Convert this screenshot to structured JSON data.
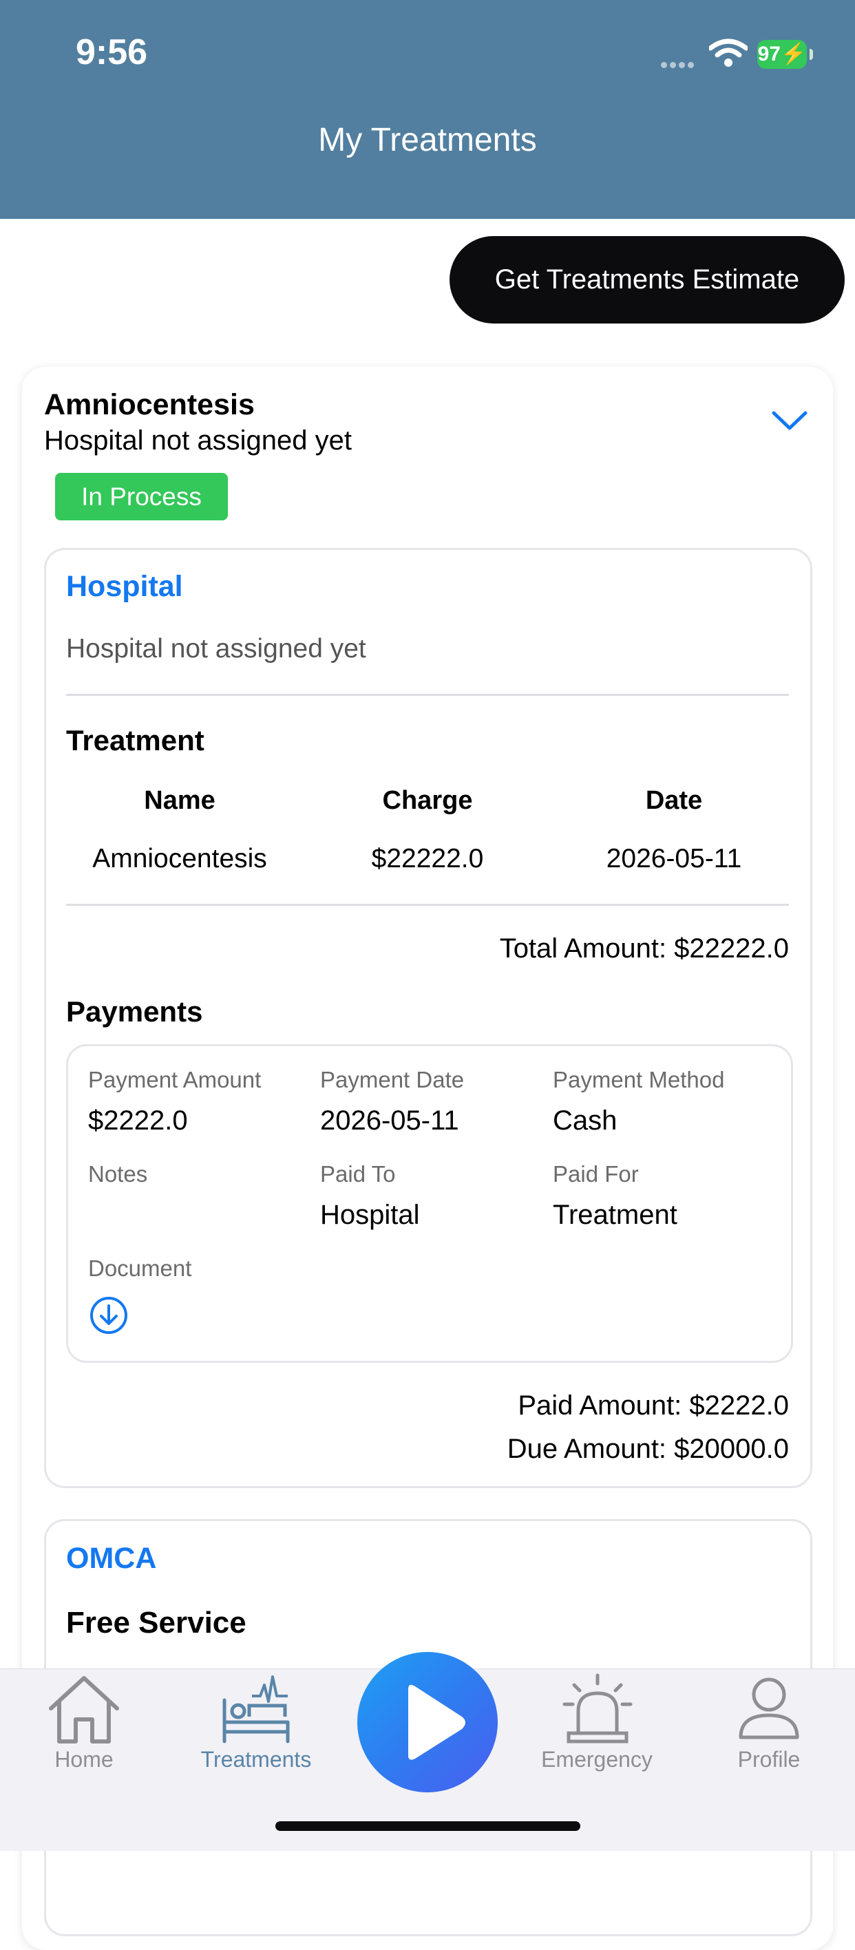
{
  "status_bar": {
    "time": "9:56",
    "battery": "97"
  },
  "header": {
    "title": "My Treatments"
  },
  "estimate_button": {
    "label": "Get Treatments Estimate"
  },
  "treatment_card": {
    "title": "Amniocentesis",
    "subtitle": "Hospital not assigned yet",
    "status": "In Process",
    "status_color": "#34c759"
  },
  "hospital_section": {
    "heading": "Hospital",
    "text": "Hospital not assigned yet",
    "treatment_heading": "Treatment",
    "table": {
      "headers": [
        "Name",
        "Charge",
        "Date"
      ],
      "rows": [
        [
          "Amniocentesis",
          "$22222.0",
          "2026-05-11"
        ]
      ]
    },
    "total": "Total Amount: $22222.0",
    "payments_heading": "Payments",
    "payment": {
      "amount_label": "Payment Amount",
      "amount": "$2222.0",
      "date_label": "Payment Date",
      "date": "2026-05-11",
      "method_label": "Payment Method",
      "method": "Cash",
      "notes_label": "Notes",
      "notes": "",
      "paid_to_label": "Paid To",
      "paid_to": "Hospital",
      "paid_for_label": "Paid For",
      "paid_for": "Treatment",
      "document_label": "Document",
      "document_icon": "download-circle-icon"
    },
    "paid": "Paid Amount: $2222.0",
    "due": "Due Amount: $20000.0"
  },
  "omca_section": {
    "heading": "OMCA",
    "text": "Free Service"
  },
  "tabbar": {
    "items": [
      {
        "label": "Home",
        "icon": "home-icon"
      },
      {
        "label": "Treatments",
        "icon": "bed-icon",
        "active": true
      },
      {
        "label": "",
        "icon": "play-icon"
      },
      {
        "label": "Emergency",
        "icon": "alarm-icon"
      },
      {
        "label": "Profile",
        "icon": "person-icon"
      }
    ]
  },
  "colors": {
    "header": "#527f9f",
    "accent": "#1478f0",
    "tab_active": "#5a85a8"
  }
}
